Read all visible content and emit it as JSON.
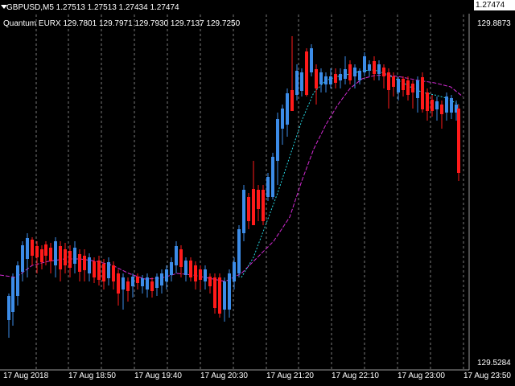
{
  "header": {
    "symbol_title": "GBPUSD,M5  1.27513 1.27513 1.27434 1.27474"
  },
  "indicator": {
    "title": "Quantum EURX  129.7801  129.7971  129.7930  129.7137  129.7250"
  },
  "price_axis": {
    "current_price": "1.27474",
    "top_label": "129.8873",
    "bottom_label": "129.5284"
  },
  "time_axis": {
    "labels": [
      "17 Aug 2018",
      "17 Aug 18:50",
      "17 Aug 19:40",
      "17 Aug 20:30",
      "17 Aug 21:20",
      "17 Aug 22:10",
      "17 Aug 23:00",
      "17 Aug 23:50"
    ]
  },
  "colors": {
    "background": "#000000",
    "bull": "#3c8ce8",
    "bear": "#ff1a1a",
    "ma_slow": "#d22ad2",
    "ma_fast": "#27d6e2",
    "grid": "#7a7a7a",
    "mini_line": "#2ecc2e"
  }
}
